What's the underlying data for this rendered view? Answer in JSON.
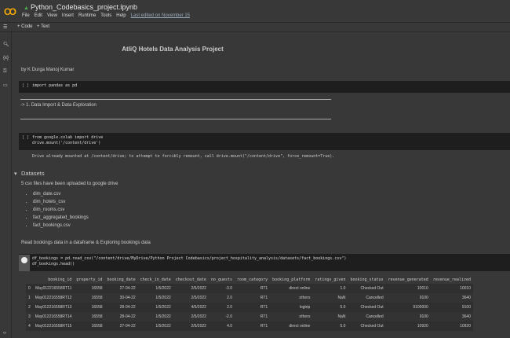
{
  "app": {
    "file_name": "Python_Codebasics_project.ipynb",
    "menu": [
      "File",
      "Edit",
      "View",
      "Insert",
      "Runtime",
      "Tools",
      "Help"
    ],
    "last_edited": "Last edited on November 15",
    "add_code": "+ Code",
    "add_text": "+ Text"
  },
  "notebook": {
    "title": "AtliQ Hotels Data Analysis Project",
    "author": "by K Durga Manoj Kumar",
    "cell1_code": "import pandas as pd",
    "section1": "-> 1. Data Import & Data Exploration",
    "cell2_line1": "from google.colab import drive",
    "cell2_line2": "drive.mount('/content/drive')",
    "cell2_output": "Drive already mounted at /content/drive; to attempt to forcibly remount, call drive.mount(\"/content/drive\", force_remount=True).",
    "datasets_heading": "Datasets",
    "datasets_text": "5 csv files have been uploaded to google drive",
    "files": [
      "dim_date.csv",
      "dim_hotels_csv",
      "dim_rooms.csv",
      "fact_aggregated_bookings",
      "fact_bookings.csv"
    ],
    "read_text": "Read bookings data in a dataframe & Exploring bookings data",
    "cell3_line1": "df_bookings = pd.read_csv(\"/content/drive/MyDrive/Python Project Codebasics/project_hospitality_analysis/datasets/fact_bookings.csv\")",
    "cell3_line2": "df_bookings.head()",
    "run_marker": "[ ]"
  },
  "table": {
    "columns": [
      "",
      "booking_id",
      "property_id",
      "booking_date",
      "check_in_date",
      "checkout_date",
      "no_guests",
      "room_category",
      "booking_platform",
      "ratings_given",
      "booking_status",
      "revenue_generated",
      "revenue_realized"
    ],
    "rows": [
      [
        "0",
        "May012216558RT11",
        "16558",
        "27-04-22",
        "1/5/2022",
        "2/5/2022",
        "-3.0",
        "RT1",
        "direct online",
        "1.0",
        "Checked Out",
        "10010",
        "10010"
      ],
      [
        "1",
        "May012216558RT12",
        "16558",
        "30-04-22",
        "1/5/2022",
        "2/5/2022",
        "2.0",
        "RT1",
        "others",
        "NaN",
        "Cancelled",
        "9100",
        "3640"
      ],
      [
        "2",
        "May012216558RT13",
        "16558",
        "28-04-22",
        "1/5/2022",
        "4/5/2022",
        "2.0",
        "RT1",
        "logtrip",
        "5.0",
        "Checked Out",
        "9100000",
        "9100"
      ],
      [
        "3",
        "May012216558RT14",
        "16558",
        "28-04-22",
        "1/5/2022",
        "2/5/2022",
        "-2.0",
        "RT1",
        "others",
        "NaN",
        "Cancelled",
        "9100",
        "3640"
      ],
      [
        "4",
        "May012216558RT15",
        "16558",
        "27-04-22",
        "1/5/2022",
        "2/5/2022",
        "4.0",
        "RT1",
        "direct online",
        "5.0",
        "Checked Out",
        "10920",
        "10920"
      ]
    ]
  }
}
